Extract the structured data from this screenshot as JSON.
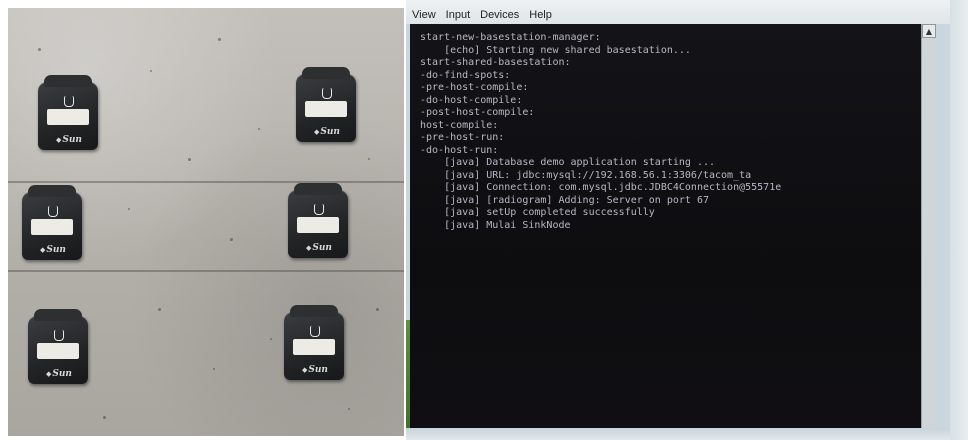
{
  "left_photo": {
    "devices": [
      {
        "label": "",
        "brand": "Sun"
      },
      {
        "label": "",
        "brand": "Sun"
      },
      {
        "label": "",
        "brand": "Sun"
      },
      {
        "label": "",
        "brand": "Sun"
      },
      {
        "label": "",
        "brand": "Sun"
      },
      {
        "label": "",
        "brand": "Sun"
      }
    ]
  },
  "right_photo": {
    "menubar": {
      "items": [
        "View",
        "Input",
        "Devices",
        "Help"
      ]
    },
    "console": {
      "lines": [
        "start-new-basestation-manager:",
        "    [echo] Starting new shared basestation...",
        "",
        "start-shared-basestation:",
        "",
        "-do-find-spots:",
        "",
        "-pre-host-compile:",
        "",
        "-do-host-compile:",
        "",
        "-post-host-compile:",
        "",
        "host-compile:",
        "",
        "-pre-host-run:",
        "",
        "-do-host-run:",
        "    [java] Database demo application starting ...",
        "    [java] URL: jdbc:mysql://192.168.56.1:3306/tacom_ta",
        "    [java] Connection: com.mysql.jdbc.JDBC4Connection@55571e",
        "    [java] [radiogram] Adding: Server on port 67",
        "    [java] setUp completed successfully",
        "    [java] Mulai SinkNode"
      ]
    },
    "scrollbar": {
      "up_icon": "triangle-up-icon"
    }
  },
  "colors": {
    "console_bg": "#0d0d10",
    "console_text": "#b7b6c4",
    "concrete": "#b9b6b1",
    "device_body": "#222426"
  }
}
